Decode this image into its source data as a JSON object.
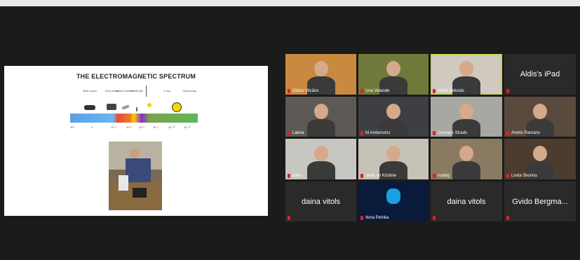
{
  "slide": {
    "title": "THE ELECTROMAGNETIC SPECTRUM",
    "bands": [
      "Radio waves",
      "Micro-waves",
      "Infrared radiation",
      "Visible light",
      "X rays",
      "Gamma rays"
    ],
    "exponents": [
      "10³",
      "1",
      "10⁻²",
      "10⁻⁵",
      "10⁻⁶",
      "10⁻⁸",
      "10⁻¹⁰",
      "10⁻¹²"
    ]
  },
  "participants": [
    {
      "name": "Diāzis Vilcāns",
      "video": true
    },
    {
      "name": "Una Velande",
      "video": true
    },
    {
      "name": "Kārlis Velunds",
      "video": true,
      "active": true
    },
    {
      "name": "Aldis's iPad",
      "video": false
    },
    {
      "name": "Laima",
      "video": true
    },
    {
      "name": "M.Andersons",
      "video": true
    },
    {
      "name": "Gundars Strads",
      "video": true
    },
    {
      "name": "Andris Ramāns",
      "video": true
    },
    {
      "name": "Girts",
      "video": true
    },
    {
      "name": "Janis un Kristine",
      "video": true
    },
    {
      "name": "rutabg",
      "video": true
    },
    {
      "name": "Linda Skorina",
      "video": true
    },
    {
      "name": "daina vitols",
      "video": false
    },
    {
      "name": "Ilona Petrika",
      "video": true
    },
    {
      "name": "daina vitols",
      "video": false
    },
    {
      "name": "Gvido Bergma...",
      "video": false
    }
  ]
}
